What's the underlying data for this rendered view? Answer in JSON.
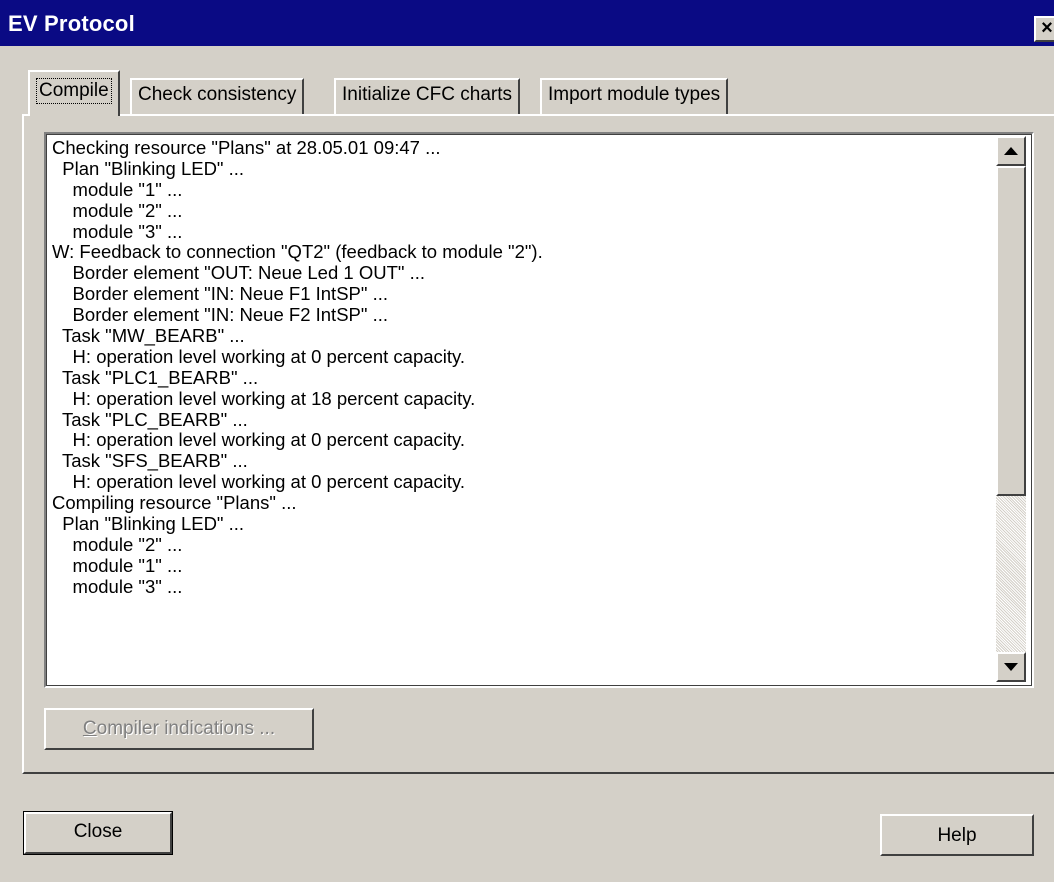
{
  "window": {
    "title": "EV Protocol",
    "close_glyph": "×"
  },
  "tabs": [
    {
      "label": "Compile",
      "active": true
    },
    {
      "label": "Check consistency",
      "active": false
    },
    {
      "label": "Initialize CFC charts",
      "active": false
    },
    {
      "label": "Import module types",
      "active": false
    }
  ],
  "log": {
    "lines": [
      "Checking resource \"Plans\" at 28.05.01 09:47 ...",
      "  Plan \"Blinking LED\" ...",
      "    module \"1\" ...",
      "    module \"2\" ...",
      "    module \"3\" ...",
      "W: Feedback to connection \"QT2\" (feedback to module \"2\").",
      "    Border element \"OUT: Neue Led 1 OUT\" ...",
      "    Border element \"IN: Neue F1 IntSP\" ...",
      "    Border element \"IN: Neue F2 IntSP\" ...",
      "  Task \"MW_BEARB\" ...",
      "    H: operation level working at 0 percent capacity.",
      "  Task \"PLC1_BEARB\" ...",
      "    H: operation level working at 18 percent capacity.",
      "  Task \"PLC_BEARB\" ...",
      "    H: operation level working at 0 percent capacity.",
      "  Task \"SFS_BEARB\" ...",
      "    H: operation level working at 0 percent capacity.",
      "Compiling resource \"Plans\" ...",
      "  Plan \"Blinking LED\" ...",
      "    module \"2\" ...",
      "    module \"1\" ...",
      "    module \"3\" ..."
    ]
  },
  "buttons": {
    "compiler_indications_first": "C",
    "compiler_indications_rest": "ompiler indications ...",
    "close": "Close",
    "help": "Help"
  },
  "icons": {
    "scroll_up": "triangle-up-icon",
    "scroll_down": "triangle-down-icon"
  }
}
